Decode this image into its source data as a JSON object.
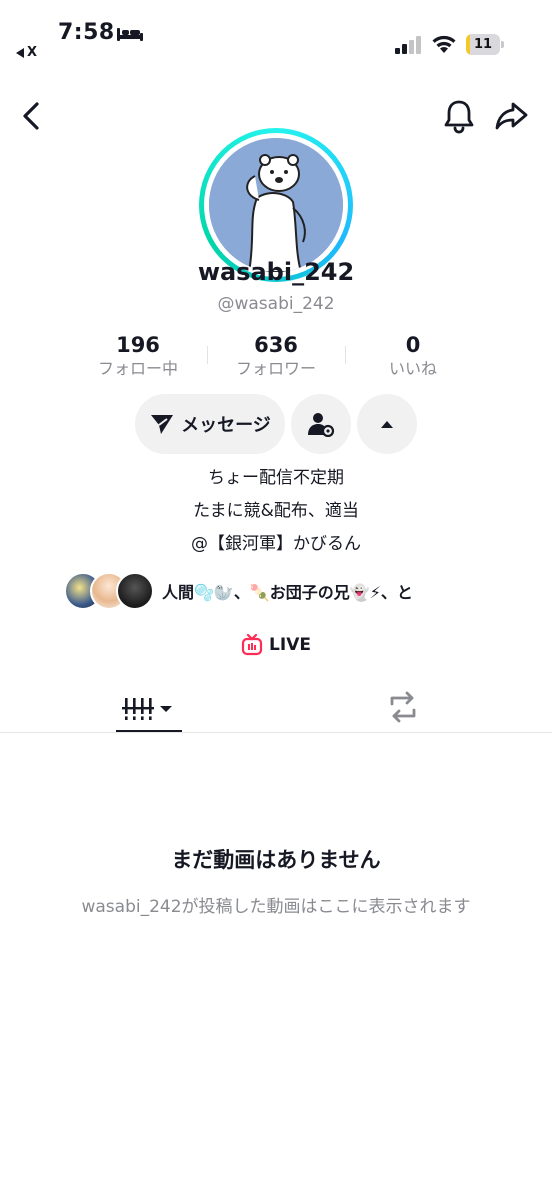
{
  "status_bar": {
    "time": "7:58",
    "back_app": "X",
    "battery_level": "11",
    "battery_fraction": 0.11,
    "icons": [
      "bed-icon",
      "signal-icon",
      "wifi-icon",
      "battery-icon"
    ]
  },
  "nav": {
    "icons": [
      "back-arrow-icon",
      "bell-icon",
      "share-icon"
    ]
  },
  "profile": {
    "display_name": "wasabi_242",
    "handle": "@wasabi_242",
    "stats": [
      {
        "value": "196",
        "label": "フォロー中"
      },
      {
        "value": "636",
        "label": "フォロワー"
      },
      {
        "value": "0",
        "label": "いいね"
      }
    ],
    "actions": {
      "message_label": "メッセージ"
    },
    "bio": [
      "ちょー配信不定期",
      "たまに競&配布、適当",
      "@【銀河軍】かびるん"
    ],
    "followed_by": "人間🫧🦭、🍡お団子の兄👻⚡、と",
    "live_label": "LIVE"
  },
  "empty_state": {
    "title": "まだ動画はありません",
    "subtitle": "wasabi_242が投稿した動画はここに表示されます"
  },
  "colors": {
    "accent_ring": "#25f4ee",
    "live_red": "#fe2c55",
    "battery_yellow": "#f4c927",
    "secondary_text": "#8a8b91"
  }
}
